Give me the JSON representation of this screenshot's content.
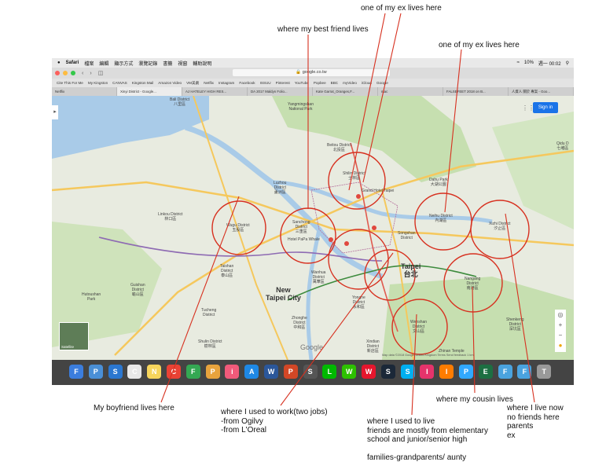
{
  "annotations": {
    "ex_top": "one of my ex lives here",
    "best_friend": "where my best friend lives",
    "ex_right": "one of my ex lives here",
    "boyfriend": "My boyfriend lives here",
    "work": "where I used to work(two jobs)\n-from Ogilvy\n-from L'Oreal",
    "lived": "where I used to live\nfriends are mostly from elementary\nschool and junior/senior high\n\nfamilies-grandparents/ aunty",
    "cousin": "where my cousin lives",
    "live_now": "where I live now\nno friends here\nparents\nex"
  },
  "menubar": {
    "apple": "",
    "items": [
      "Safari",
      "檔案",
      "編輯",
      "顯示方式",
      "瀏覽記錄",
      "書籤",
      "視窗",
      "輔助說明"
    ],
    "right": [
      "10%",
      "週一 00:02"
    ]
  },
  "browser": {
    "url": "google.co.tw",
    "bookmarks": [
      "Cite This For Me",
      "My Kingston",
      "CANVAS",
      "Kingston Mail",
      "Amazon Video",
      "VM美劇",
      "Netflix",
      "Instagram",
      "Facebook",
      "ISSUU",
      "Pinterest",
      "YouTube",
      "Popbee",
      "BBC",
      "myVideo",
      "iCloud",
      "Google"
    ],
    "tabs": [
      "Netflix",
      "Xinyi District - Google...",
      "AJ HATELEY HIGH RES...",
      "DA 2017 Maldyn Folio...",
      "Kate Garrat_Oranges,F...",
      "mac",
      "FALSEFEET 2018 on B...",
      "人資人 關於 專案 - Goo..."
    ],
    "active_tab": 1
  },
  "map": {
    "signin": "Sign in",
    "google": "Google",
    "satellite": "Satellite",
    "footer": "Map data ©2018 Google   United Kingdom   Terms   Send feedback   1 km",
    "labels": {
      "bali": "Bali District\n八里區",
      "wugu": "Wugu District\n五股區",
      "linkou": "Linkou District\n林口區",
      "luzhou": "Luzhou\nDistrict\n蘆洲區",
      "sanchong": "Sanchong\nDistrict\n三重區",
      "taishan": "Taishan\nDistrict\n泰山區",
      "beitou": "Beitou District\n北投區",
      "shilin": "Shilin District\n士林區",
      "neihu": "Neihu District\n內湖區",
      "xizhi": "Xizhi District\n汐止區",
      "songshan": "Songshan\nDistrict",
      "taipei": "Taipei\n台北",
      "newtaipei": "New\nTaipei City",
      "wanhua": "Wanhua\nDistrict\n萬華區",
      "yonghe": "Yonghe\nDistrict\n永和區",
      "zhonghe": "Zhonghe\nDistrict\n中和區",
      "nangang": "Nangang\nDistrict\n南港區",
      "wenshan": "Wenshan\nDistrict\n文山區",
      "xindian": "Xindian\nDistrict\n新店區",
      "shenkeng": "Shenkeng\nDistrict\n深坑區",
      "tucheng": "Tucheng\nDistrict",
      "shulin": "Shulin District\n樹林區",
      "guishan": "Guishan\nDistrict\n龜山區",
      "hutoushan": "Hutoushan\nPark",
      "dahu": "Dahu Park\n大湖公園",
      "qidu": "Qidu D\n七堵區",
      "grandhotel": "Grand Hotel Taipei",
      "hotelpapa": "Hotel PaPa Whale",
      "yangming": "Yangmingshan\nNational Park",
      "zhinan": "Zhinan Temple"
    }
  },
  "colors": {
    "circle": "#d7301f",
    "river": "#a9cbe8",
    "green": "#c6dfb0",
    "road": "#f5c85d",
    "pointer": "#d7301f"
  },
  "dock": [
    "Finder",
    "Preview",
    "Safari",
    "Calendar",
    "Notes",
    "Chrome",
    "FaceTime",
    "Photos",
    "iTunes",
    "App Store",
    "Word",
    "PowerPoint",
    "Screenshot",
    "LINE",
    "WeChat",
    "Weibo",
    "Steam",
    "Skype",
    "InDesign",
    "Illustrator",
    "Photoshop",
    "Excel",
    "Folder",
    "Folder",
    "Trash"
  ]
}
